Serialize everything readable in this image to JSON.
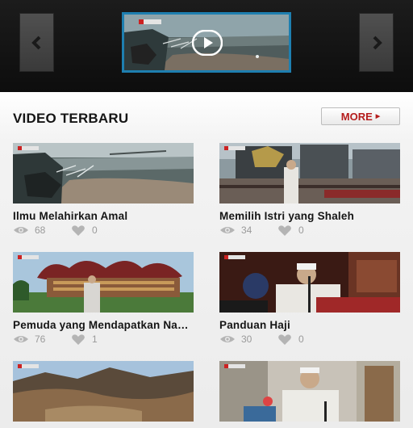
{
  "carousel": {
    "prev_label": "previous",
    "next_label": "next",
    "featured_label": "featured video"
  },
  "section": {
    "title": "VIDEO TERBARU",
    "more_label": "MORE"
  },
  "videos": [
    {
      "title": "Ilmu Melahirkan Amal",
      "views": "68",
      "likes": "0"
    },
    {
      "title": "Memilih Istri yang Shaleh",
      "views": "34",
      "likes": "0"
    },
    {
      "title": "Pemuda yang Mendapatkan Naungan Allah",
      "views": "76",
      "likes": "1"
    },
    {
      "title": "Panduan Haji",
      "views": "30",
      "likes": "0"
    },
    {
      "title": "",
      "views": "",
      "likes": ""
    },
    {
      "title": "",
      "views": "",
      "likes": ""
    }
  ],
  "colors": {
    "accent_blue": "#1e7fb0",
    "more_red": "#b51d1d",
    "stat_grey": "#9a9a9a"
  }
}
